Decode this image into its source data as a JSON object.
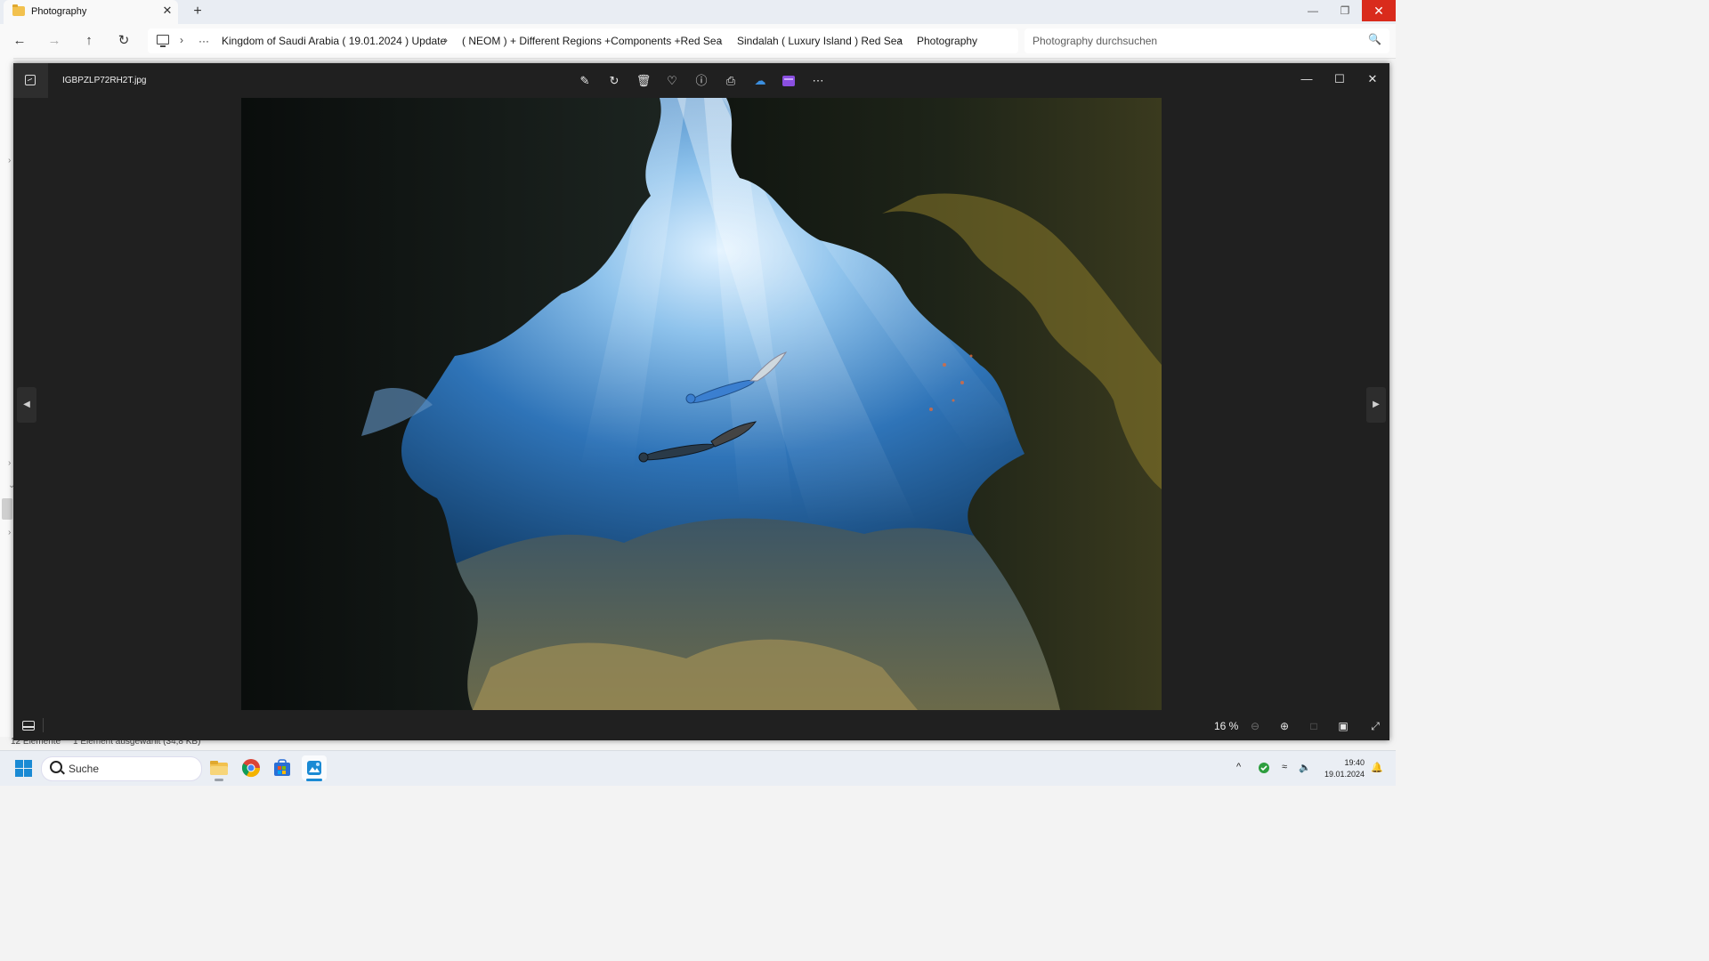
{
  "explorer": {
    "tab_title": "Photography",
    "tab_close": "✕",
    "tab_new": "+",
    "window_controls": {
      "minimize": "—",
      "maximize": "❐",
      "close": "✕"
    },
    "nav": {
      "back": "←",
      "forward": "→",
      "up": "↑",
      "refresh": "↻"
    },
    "breadcrumb": {
      "more": "···",
      "separator": "›",
      "items": [
        "Kingdom of Saudi Arabia ( 19.01.2024 ) Update",
        "( NEOM ) + Different Regions +Components +Red Sea",
        "Sindalah ( Luxury Island ) Red Sea",
        "Photography"
      ]
    },
    "search_placeholder": "Photography durchsuchen",
    "status": {
      "count": "12 Elemente",
      "selected": "1 Element ausgewählt (34,8 KB)"
    }
  },
  "viewer": {
    "file_name": "IGBPZLP72RH2T.jpg",
    "toolbar_icons": [
      "edit-icon",
      "rotate-icon",
      "delete-icon",
      "favorite-icon",
      "info-icon",
      "print-icon",
      "onedrive-icon",
      "clipchamp-icon",
      "more-icon"
    ],
    "window_controls": {
      "minimize": "—",
      "maximize": "☐",
      "close": "✕"
    },
    "nav": {
      "prev": "◀",
      "next": "▶"
    },
    "zoom_level": "16 %",
    "photo_subject": "underwater-cave-freedivers"
  },
  "taskbar": {
    "search_label": "Suche",
    "apps": [
      "file-explorer-icon",
      "chrome-icon",
      "store-icon",
      "photos-icon"
    ],
    "tray": {
      "chevron": "^",
      "time": "19:40",
      "date": "19.01.2024"
    }
  },
  "colors": {
    "close_red": "#d92b1c",
    "viewer_bg": "#202020",
    "accent_blue": "#1a8ad4",
    "folder_yellow": "#f2c14e"
  }
}
